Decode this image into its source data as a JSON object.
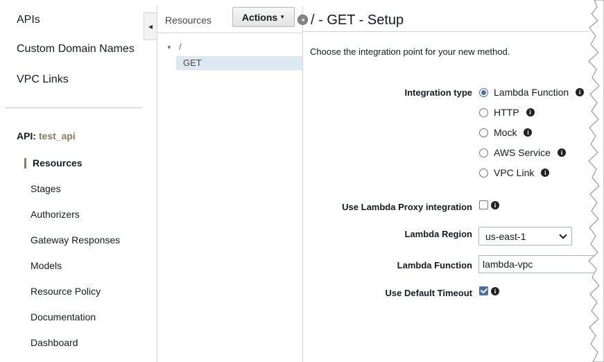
{
  "sidebar": {
    "top_links": [
      "APIs",
      "Custom Domain Names",
      "VPC Links"
    ],
    "api_prefix": "API:",
    "api_name": "test_api",
    "nav_items": [
      "Resources",
      "Stages",
      "Authorizers",
      "Gateway Responses",
      "Models",
      "Resource Policy",
      "Documentation",
      "Dashboard"
    ],
    "active_item": "Resources"
  },
  "resources_pane": {
    "header": "Resources",
    "actions_label": "Actions",
    "tree_root": "/",
    "tree_selected": "GET"
  },
  "setup": {
    "title": "/ - GET - Setup",
    "intro": "Choose the integration point for your new method.",
    "integration_type_label": "Integration type",
    "integration_options": [
      "Lambda Function",
      "HTTP",
      "Mock",
      "AWS Service",
      "VPC Link"
    ],
    "selected_integration": "Lambda Function",
    "proxy_label": "Use Lambda Proxy integration",
    "proxy_checked": false,
    "region_label": "Lambda Region",
    "region_value": "us-east-1",
    "function_label": "Lambda Function",
    "function_value": "lambda-vpc",
    "timeout_label": "Use Default Timeout",
    "timeout_checked": true
  },
  "colors": {
    "accent": "#8c7a5b",
    "selection": "#dde8f2",
    "radio_checked": "#4a6fa5"
  },
  "icons": {
    "info": "info-icon",
    "collapse": "collapse-arrow-icon",
    "tree_expand": "tree-expand-icon",
    "dropdown": "chevron-down-icon"
  }
}
